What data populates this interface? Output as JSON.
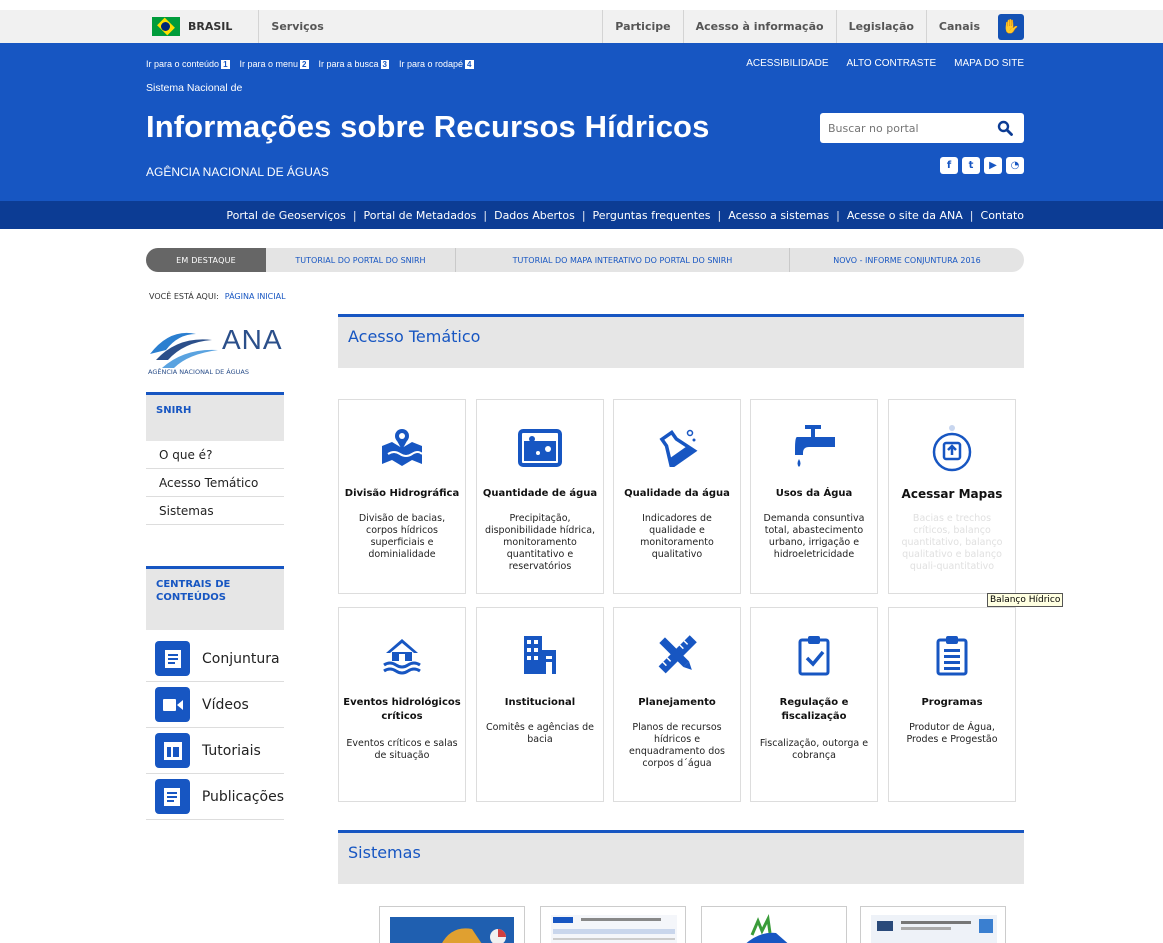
{
  "govbar": {
    "country": "BRASIL",
    "services": "Serviços",
    "links": [
      "Participe",
      "Acesso à informação",
      "Legislação",
      "Canais"
    ]
  },
  "header": {
    "skip_links": [
      {
        "label": "Ir para o conteúdo",
        "key": "1"
      },
      {
        "label": "Ir para o menu",
        "key": "2"
      },
      {
        "label": "Ir para a busca",
        "key": "3"
      },
      {
        "label": "Ir para o rodapé",
        "key": "4"
      }
    ],
    "top_links": [
      "ACESSIBILIDADE",
      "ALTO CONTRASTE",
      "MAPA DO SITE"
    ],
    "subtitle": "Sistema Nacional de",
    "title": "Informações sobre Recursos Hídricos",
    "agency": "AGÊNCIA NACIONAL DE ÁGUAS",
    "search_placeholder": "Buscar no portal"
  },
  "nav": [
    "Portal de Geoserviços",
    "Portal de Metadados",
    "Dados Abertos",
    "Perguntas frequentes",
    "Acesso a sistemas",
    "Acesse o site da ANA",
    "Contato"
  ],
  "highlights": {
    "label": "EM DESTAQUE",
    "items": [
      "TUTORIAL DO PORTAL DO SNIRH",
      "TUTORIAL DO MAPA INTERATIVO DO PORTAL DO SNIRH",
      "NOVO - INFORME CONJUNTURA 2016"
    ]
  },
  "breadcrumb": {
    "prefix": "VOCÊ ESTÁ AQUI:",
    "current": "PÁGINA INICIAL"
  },
  "logo": {
    "name": "ANA",
    "subtitle": "AGÊNCIA NACIONAL DE ÁGUAS"
  },
  "sidebar": {
    "snirh_title": "SNIRH",
    "snirh_items": [
      "O que é?",
      "Acesso Temático",
      "Sistemas"
    ],
    "central_title_1": "CENTRAIS DE",
    "central_title_2": "CONTEÚDOS",
    "central_items": [
      "Conjuntura",
      "Vídeos",
      "Tutoriais",
      "Publicações"
    ]
  },
  "main": {
    "acesso_title": "Acesso Temático",
    "cards": [
      {
        "title": "Divisão Hidrográfica",
        "desc": "Divisão de bacias, corpos hídricos superficiais e dominialidade"
      },
      {
        "title": "Quantidade de água",
        "desc": "Precipitação, disponibilidade hídrica, monitoramento quantitativo e reservatórios"
      },
      {
        "title": "Qualidade da água",
        "desc": "Indicadores de qualidade e monitoramento qualitativo"
      },
      {
        "title": "Usos da Água",
        "desc": "Demanda consuntiva total, abastecimento urbano, irrigação e hidroeletricidade"
      },
      {
        "title": "Acessar Mapas",
        "desc": "Bacias e trechos críticos, balanço quantitativo, balanço qualitativo e balanço quali-quantitativo"
      },
      {
        "title": "Eventos hidrológicos críticos",
        "desc": "Eventos críticos e salas de situação"
      },
      {
        "title": "Institucional",
        "desc": "Comitês e agências de bacia"
      },
      {
        "title": "Planejamento",
        "desc": "Planos de recursos hídricos e enquadramento dos corpos d´água"
      },
      {
        "title": "Regulação e fiscalização",
        "desc": "Fiscalização, outorga e cobrança"
      },
      {
        "title": "Programas",
        "desc": "Produtor de Água, Prodes e Progestão"
      }
    ],
    "tooltip": "Balanço Hídrico",
    "sistemas_title": "Sistemas"
  },
  "colors": {
    "primary": "#1756c2",
    "navbar": "#0c3c94",
    "panel": "#e6e6e6"
  }
}
